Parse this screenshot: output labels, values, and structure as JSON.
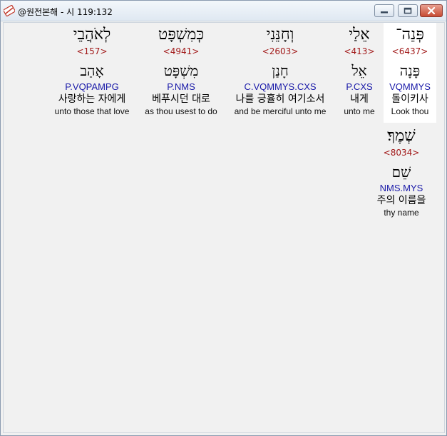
{
  "window": {
    "title": "@원전본해 - 시 119:132",
    "app_icon": "bible-app-icon",
    "minimize_icon": "minimize-icon",
    "maximize_icon": "maximize-icon",
    "close_icon": "close-icon"
  },
  "words": [
    {
      "hebrew": "פְּנֵה־",
      "strong": "<6437>",
      "root": "פָּנָה",
      "morph": "VQMMYS",
      "korean": "돌이키사",
      "english": "Look thou",
      "highlight": true
    },
    {
      "hebrew": "אֵלַי",
      "strong": "<413>",
      "root": "אֵל",
      "morph": "P.CXS",
      "korean": "내게",
      "english": "unto me"
    },
    {
      "hebrew": "וְחָנֵּנִי",
      "strong": "<2603>",
      "root": "חָנַן",
      "morph": "C.VQMMYS.CXS",
      "korean": "나를 긍휼히 여기소서",
      "english": "and be merciful unto me"
    },
    {
      "hebrew": "כְּמִשְׁפָּט",
      "strong": "<4941>",
      "root": "מִשְׁפָּט",
      "morph": "P.NMS",
      "korean": "베푸시던 대로",
      "english": "as thou usest to do"
    },
    {
      "hebrew": "לְאֹהֲבֵי",
      "strong": "<157>",
      "root": "אָהַב",
      "morph": "P.VQPAMPG",
      "korean": "사랑하는 자에게",
      "english": "unto those that love"
    },
    {
      "hebrew": "שְׁמֶךָ׃",
      "strong": "<8034>",
      "root": "שֵׁם",
      "morph": "NMS.MYS",
      "korean": "주의 이름을",
      "english": "thy name"
    }
  ]
}
